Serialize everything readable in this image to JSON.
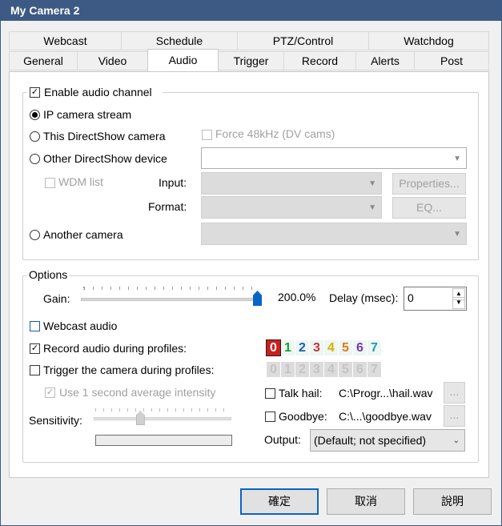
{
  "window": {
    "title": "My Camera 2"
  },
  "tabs": {
    "row1": [
      "Webcast",
      "Schedule",
      "PTZ/Control",
      "Watchdog"
    ],
    "row2": [
      "General",
      "Video",
      "Audio",
      "Trigger",
      "Record",
      "Alerts",
      "Post"
    ],
    "active": "Audio"
  },
  "audio": {
    "enable_label": "Enable audio channel",
    "enable_checked": true,
    "source_ip": "IP camera stream",
    "source_this_ds": "This DirectShow camera",
    "force48": "Force 48kHz (DV cams)",
    "source_other_ds": "Other DirectShow device",
    "wdm_list": "WDM list",
    "input_label": "Input:",
    "format_label": "Format:",
    "properties_btn": "Properties...",
    "eq_btn": "EQ...",
    "source_another": "Another camera",
    "selected_source": "IP camera stream"
  },
  "options": {
    "legend": "Options",
    "gain_label": "Gain:",
    "gain_value": "200.0%",
    "gain_fraction": 1.0,
    "delay_label": "Delay (msec):",
    "delay_value": "0",
    "webcast_audio": "Webcast audio",
    "record_audio": "Record audio during profiles:",
    "trigger_camera": "Trigger the camera during profiles:",
    "use_avg": "Use 1 second average intensity",
    "sensitivity_label": "Sensitivity:",
    "sensitivity_fraction": 0.33,
    "talk_hail_label": "Talk hail:",
    "talk_hail_path": "C:\\Progr...\\hail.wav",
    "goodbye_label": "Goodbye:",
    "goodbye_path": "C:\\...\\goodbye.wav",
    "browse_btn": "...",
    "output_label": "Output:",
    "output_value": "(Default; not specified)",
    "profiles": [
      "0",
      "1",
      "2",
      "3",
      "4",
      "5",
      "6",
      "7"
    ],
    "profile_colors": [
      "#ffffff",
      "#1a9a3a",
      "#1a5fb4",
      "#c8323c",
      "#d9b000",
      "#e07a10",
      "#7a3aa8",
      "#1aa0a8"
    ]
  },
  "buttons": {
    "ok": "確定",
    "cancel": "取消",
    "help": "說明"
  }
}
